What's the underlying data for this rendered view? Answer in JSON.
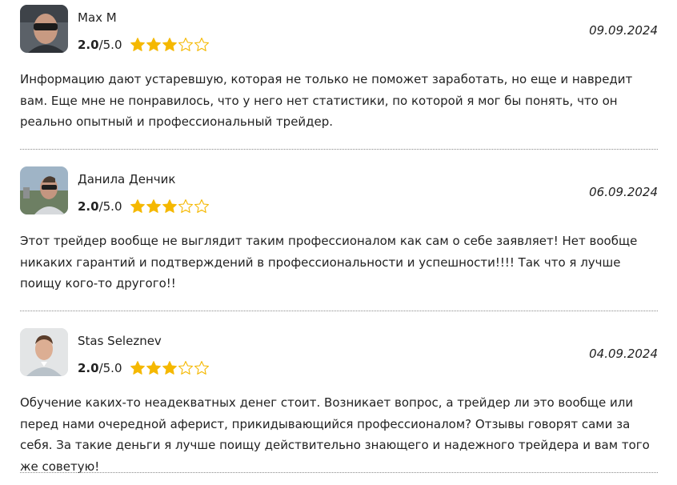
{
  "reviews": [
    {
      "author": "Max M",
      "avatar_icon": "user-photo-max-icon",
      "rating_value": "2.0",
      "rating_max": "/5.0",
      "rating": 3,
      "date": "09.09.2024",
      "text": "Информацию дают устаревшую, которая не только не поможет заработать, но еще и навредит вам. Еще мне не понравилось, что у него нет статистики, по которой я мог бы понять, что он реально опытный и профессиональный трейдер."
    },
    {
      "author": "Данила Денчик",
      "avatar_icon": "user-photo-danila-icon",
      "rating_value": "2.0",
      "rating_max": "/5.0",
      "rating": 3,
      "date": "06.09.2024",
      "text": "Этот трейдер вообще не выглядит таким профессионалом как сам о себе заявляет! Нет вообще никаких гарантий и подтверждений в профессиональности и успешности!!!! Так что я лучше поищу кого-то другого!!"
    },
    {
      "author": "Stas Seleznev",
      "avatar_icon": "user-photo-stas-icon",
      "rating_value": "2.0",
      "rating_max": "/5.0",
      "rating": 3,
      "date": "04.09.2024",
      "text": "Обучение каких-то неадекватных денег стоит. Возникает вопрос, а трейдер ли это вообще или перед нами очередной аферист, прикидывающийся профессионалом? Отзывы говорят сами за себя. За такие деньги я лучше поищу действительно знающего и надежного трейдера и вам того же советую!"
    }
  ],
  "colors": {
    "star_filled": "#f5b800",
    "star_empty": "#f5b800",
    "text": "#222222",
    "divider": "#8a8a8a"
  }
}
